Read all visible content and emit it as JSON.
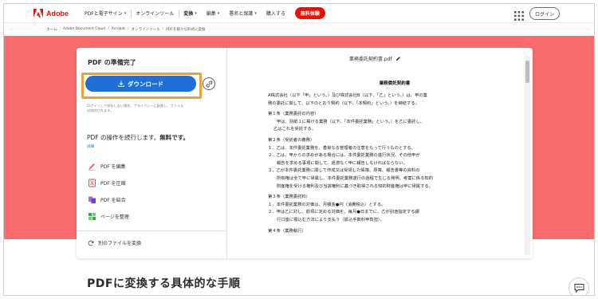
{
  "topnav": {
    "logo_text": "Adobe",
    "items": [
      {
        "label": "PDFと電子サイン",
        "chevron": true
      },
      {
        "label": "オンラインツール",
        "chevron": false
      },
      {
        "label": "変換",
        "chevron": true
      },
      {
        "label": "編集",
        "chevron": true
      },
      {
        "label": "署名と保護",
        "chevron": true
      },
      {
        "label": "購入する",
        "chevron": false
      }
    ],
    "cta_label": "無料体験",
    "login_label": "ログイン",
    "apps_icon": "grid-icon"
  },
  "breadcrumb": [
    "ホーム",
    "Adobe Document Cloud",
    "Acrobat",
    "オンラインツール",
    "PDFを様々な形式に変換"
  ],
  "left_panel": {
    "title": "PDF の準備完了",
    "download_label": "ダウンロード",
    "fine_print_lines": [
      "ログインして保存しない場合、プライバシーに配慮し、ファイル",
      "は削除されます。"
    ],
    "continue_text": "PDF の操作を続行します。",
    "continue_bold": "無料です。",
    "detail_link": "詳細",
    "tools": [
      {
        "label": "PDF を編集",
        "icon": "edit-pdf-icon"
      },
      {
        "label": "PDF を圧縮",
        "icon": "compress-pdf-icon"
      },
      {
        "label": "PDF を結合",
        "icon": "combine-pdf-icon"
      },
      {
        "label": "ページを整理",
        "icon": "organize-pages-icon"
      }
    ],
    "convert_other_label": "別のファイルを変換"
  },
  "document": {
    "filename": "業務委託契約書.pdf",
    "title": "業務委託契約書",
    "lines": [
      {
        "text": "A株式会社（以下「甲」という。）及び株式会社B（以下、「乙」という。）は、甲の業",
        "cls": ""
      },
      {
        "text": "務の委託に関して、以下のとおり契約（以下、「本契約」という。）を締結する。",
        "cls": ""
      },
      {
        "text": "第１条（業務委託の内容）",
        "cls": "gap"
      },
      {
        "text": "甲は、別紙１に掲げる業務（以下、「本件委託業務」という。）を乙に委託し、",
        "cls": "ind2"
      },
      {
        "text": "乙はこれを受託する。",
        "cls": "ind"
      },
      {
        "text": "第２条（受託者の義務）",
        "cls": "gap"
      },
      {
        "text": "１．乙は、本件委託業務を、善良なる管理者の注意をもって行うものとする。",
        "cls": ""
      },
      {
        "text": "２．乙は、甲からの求めがある場合には、本件委託業務の進行状況、その他甲が",
        "cls": ""
      },
      {
        "text": "報告を求める事項に関して、遅滞なく甲に報告しなければならない。",
        "cls": "ind2"
      },
      {
        "text": "３．乙が本件委託業務に関して作成又は受領した帳簿、原簿、報告書等の資料の",
        "cls": ""
      },
      {
        "text": "所有権は全て甲に帰属し、本件委託業務遂行の過程で生じる発明、考案に係る知的",
        "cls": "ind2"
      },
      {
        "text": "財産権を受ける権利及び当該権利に基づき取得される知的財産権は甲に帰属する。",
        "cls": "ind2"
      },
      {
        "text": "第３条（業務委託料）",
        "cls": "gap"
      },
      {
        "text": "１．本件委託業務の対価は、月額金●円（消費税込）とする。",
        "cls": ""
      },
      {
        "text": "２．甲は乙に対し、前項に定める対価を、毎月●日までに、乙が別途指定する銀",
        "cls": ""
      },
      {
        "text": "行口座に振込む方法により支払う（振込手数料甲負担）。",
        "cls": "ind2"
      },
      {
        "text": "第４条（業務執行）",
        "cls": "gap"
      }
    ]
  },
  "bottom": {
    "heading": "PDFに変換する具体的な手順"
  },
  "colors": {
    "hero_bg": "#fa6b6b",
    "brand_red": "#eb1000",
    "download_blue": "#1f6fd6",
    "highlight_orange": "#e8a33a"
  }
}
